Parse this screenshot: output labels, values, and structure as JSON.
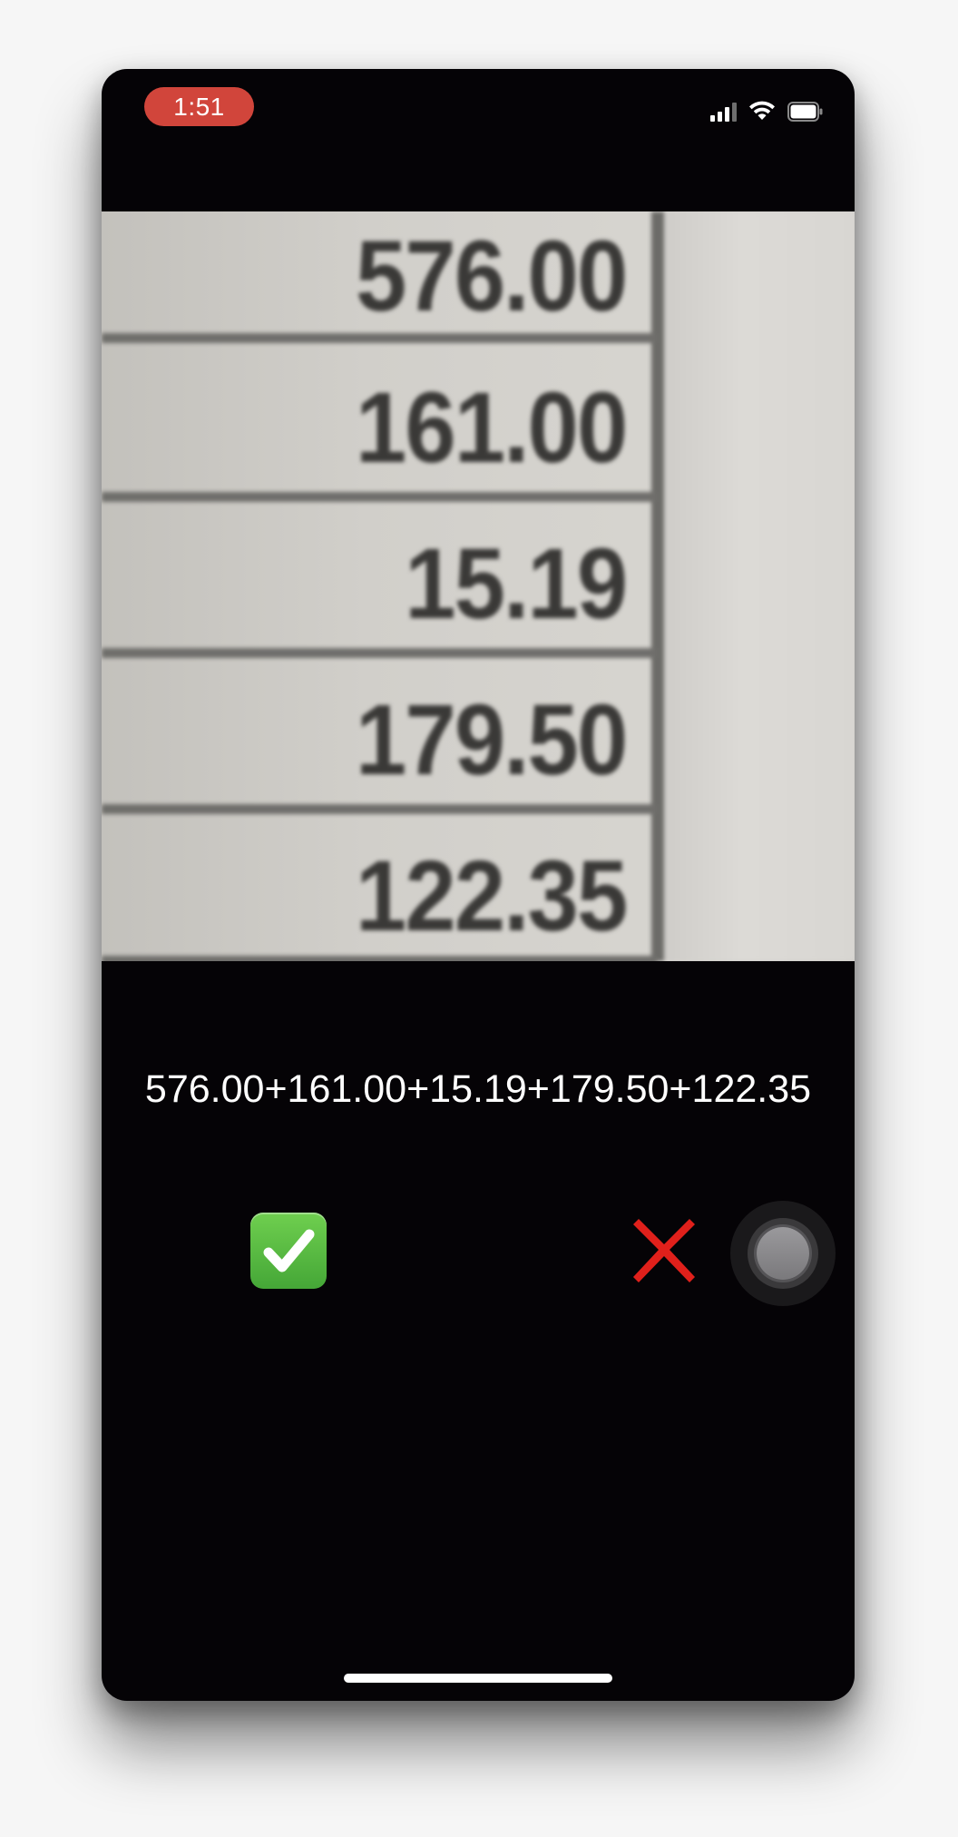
{
  "status_bar": {
    "time": "1:51",
    "recording_color": "#d1453b",
    "icons": [
      "cellular-signal-icon",
      "wifi-icon",
      "battery-icon"
    ]
  },
  "camera_preview": {
    "values": [
      "576.00",
      "161.00",
      "15.19",
      "179.50",
      "122.35"
    ]
  },
  "result": {
    "expression": "576.00+161.00+15.19+179.50+122.35"
  },
  "actions": {
    "confirm_icon": "check-mark-button-icon",
    "confirm_color": "#45a737",
    "cancel_icon": "cross-mark-icon",
    "cancel_color": "#e0201b",
    "assistive_touch_icon": "assistive-touch-icon"
  }
}
